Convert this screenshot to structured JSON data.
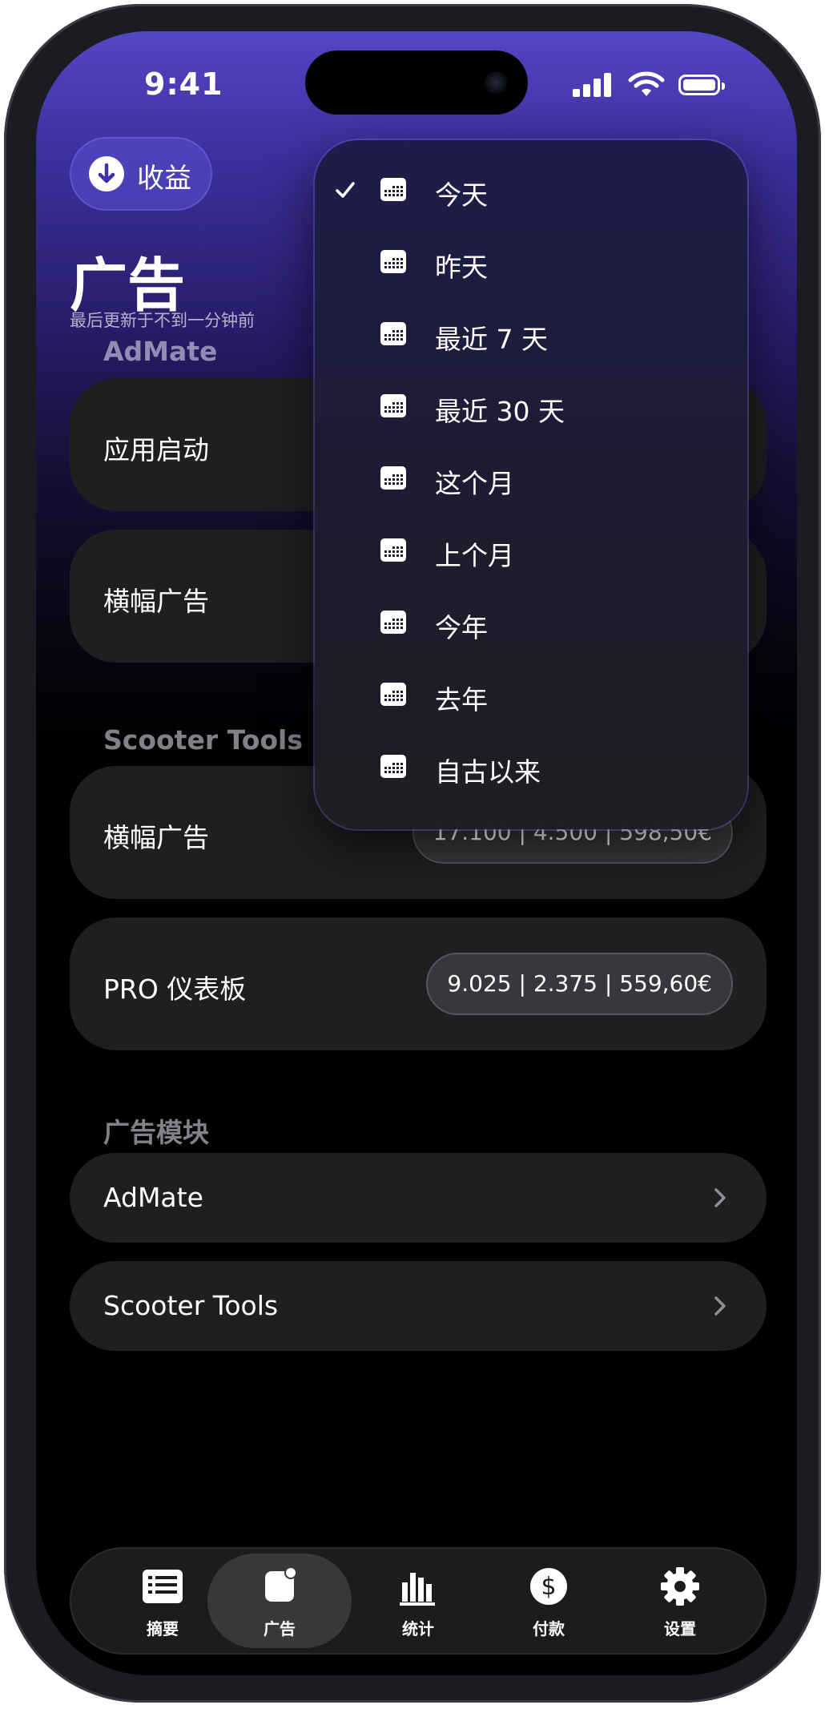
{
  "status_bar": {
    "time": "9:41"
  },
  "header": {
    "earnings_button": "收益",
    "title": "广告",
    "subtitle": "最后更新于不到一分钟前"
  },
  "sections": [
    {
      "title": "AdMate",
      "items": [
        {
          "label": "应用启动"
        },
        {
          "label": "横幅广告"
        }
      ]
    },
    {
      "title": "Scooter Tools",
      "items": [
        {
          "label": "横幅广告",
          "value": "17.100 | 4.500 | 598,50€"
        },
        {
          "label": "PRO 仪表板",
          "value": "9.025 | 2.375 | 559,60€"
        }
      ]
    },
    {
      "title": "广告模块",
      "links": [
        {
          "label": "AdMate"
        },
        {
          "label": "Scooter Tools"
        }
      ]
    }
  ],
  "date_menu": {
    "selected_index": 0,
    "items": [
      "今天",
      "昨天",
      "最近 7 天",
      "最近 30 天",
      "这个月",
      "上个月",
      "今年",
      "去年",
      "自古以来"
    ]
  },
  "tab_bar": {
    "active_index": 1,
    "tabs": [
      {
        "label": "摘要",
        "icon": "list-icon"
      },
      {
        "label": "广告",
        "icon": "ad-icon"
      },
      {
        "label": "统计",
        "icon": "bar-chart-icon"
      },
      {
        "label": "付款",
        "icon": "dollar-icon"
      },
      {
        "label": "设置",
        "icon": "gear-icon"
      }
    ]
  }
}
